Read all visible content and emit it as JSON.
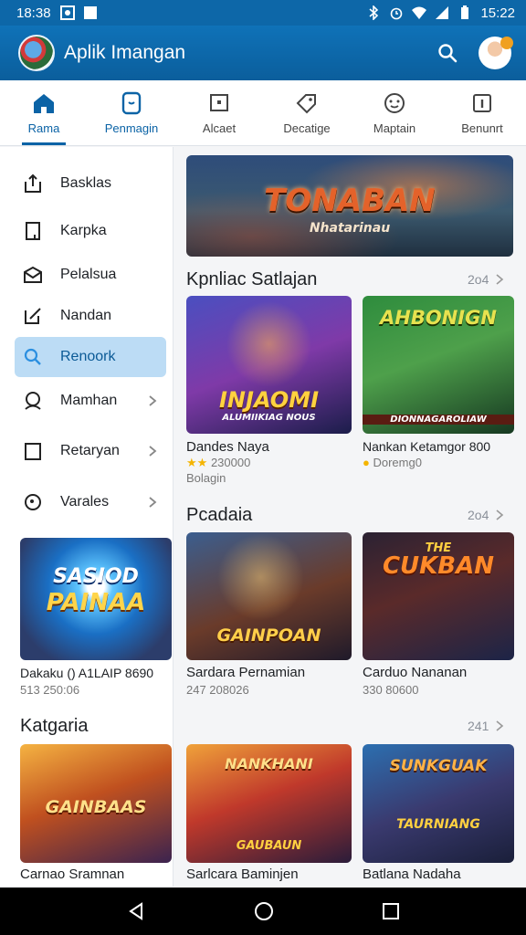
{
  "status_bar": {
    "time_left": "18:38",
    "time_right": "15:22"
  },
  "app_bar": {
    "title": "Aplik Imangan"
  },
  "tabs": [
    {
      "label": "Rama",
      "icon": "home-icon"
    },
    {
      "label": "Penmagin",
      "icon": "tablet-icon"
    },
    {
      "label": "Alcaet",
      "icon": "screen-icon"
    },
    {
      "label": "Decatige",
      "icon": "tag-icon"
    },
    {
      "label": "Maptain",
      "icon": "smile-icon"
    },
    {
      "label": "Benunrt",
      "icon": "info-icon"
    }
  ],
  "sidebar": {
    "items": [
      {
        "label": "Basklas",
        "icon": "share-icon",
        "chevron": false
      },
      {
        "label": "Karpka",
        "icon": "file-icon",
        "chevron": false
      },
      {
        "label": "Pelalsua",
        "icon": "envelope-icon",
        "chevron": false
      },
      {
        "label": "Nandan",
        "icon": "edit-icon",
        "chevron": false
      },
      {
        "label": "Renoork",
        "icon": "search-icon",
        "chevron": false
      },
      {
        "label": "Mamhan",
        "icon": "user-icon",
        "chevron": true
      },
      {
        "label": "Retaryan",
        "icon": "window-icon",
        "chevron": true
      },
      {
        "label": "Varales",
        "icon": "search-circle-icon",
        "chevron": true
      }
    ],
    "promo": {
      "art_text_1": "SASIOD",
      "art_text_2": "PAINAA",
      "title": "Dakaku () A1LAIP 8690",
      "meta": "513 250:06"
    }
  },
  "banner": {
    "art_text": "TONABAN",
    "art_sub": "Nhatarinau"
  },
  "sections": [
    {
      "title": "Kpnliac Satlajan",
      "more": "2o4",
      "cards": [
        {
          "art_text": "INJAOMI",
          "art_sub": "ALUMIIKIAG NOUS",
          "title": "Dandes Naya",
          "rating": "★★",
          "meta": "230000",
          "meta2": "Bolagin"
        },
        {
          "art_text": "AHBONIGN",
          "art_sub": "DIONNAGAROLIAW",
          "title": "Nankan Ketamgor 800",
          "rating": "●",
          "meta": "Doremg0"
        }
      ]
    },
    {
      "title": "Pcadaia",
      "more": "2o4",
      "cards": [
        {
          "art_text": "GAINPOAN",
          "art_sub": "",
          "title": "Sardara Pernamian",
          "meta": "247 208026"
        },
        {
          "art_text": "CUKBAN",
          "art_sub": "THE",
          "title": "Carduo Nananan",
          "meta": "330 80600"
        }
      ]
    },
    {
      "title": "Katgaria",
      "more": "241",
      "cards": [
        {
          "art_text": "GAINBAAS",
          "art_sub": "",
          "title": "Carnao Sramnan",
          "meta": ""
        },
        {
          "art_text": "NANKHANI",
          "art_sub": "GAUBAUN",
          "title": "Sarlcara Baminjen",
          "meta": ""
        },
        {
          "art_text": "SUNKGUAK",
          "art_sub": "TAURNIANG",
          "title": "Batlana Nadaha",
          "meta": ""
        }
      ]
    }
  ],
  "colors": {
    "primary": "#0d67a8",
    "selected_bg": "#bcdcf5",
    "accent_gold": "#f4b400"
  }
}
